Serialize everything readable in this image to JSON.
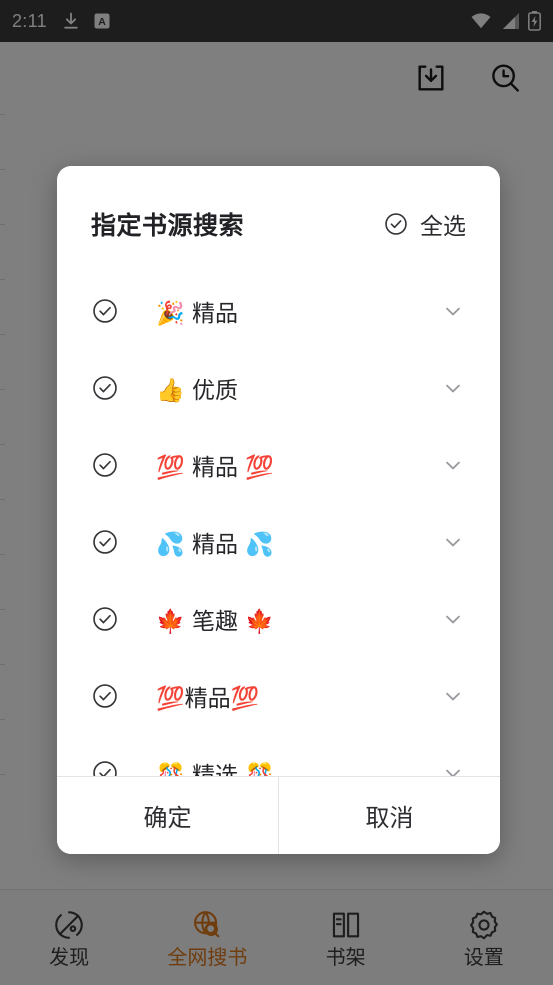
{
  "status_bar": {
    "clock": "2:11",
    "left_icons": [
      "download-icon",
      "android-auto-icon"
    ],
    "right_icons": [
      "wifi-icon",
      "cellular-signal-icon",
      "battery-charging-icon"
    ]
  },
  "app_toolbar": {
    "buttons": [
      {
        "name": "import-source-icon",
        "label": ""
      },
      {
        "name": "search-history-icon",
        "label": ""
      }
    ]
  },
  "dialog": {
    "title": "指定书源搜索",
    "select_all": {
      "label": "全选",
      "icon": "check-circle-icon",
      "checked": true
    },
    "sources": [
      {
        "name": "🎉 精品",
        "checked": true,
        "expand_icon": "chevron-down-icon"
      },
      {
        "name": "👍 优质",
        "checked": true,
        "expand_icon": "chevron-down-icon"
      },
      {
        "name": "💯 精品 💯",
        "checked": true,
        "expand_icon": "chevron-down-icon"
      },
      {
        "name": "💦 精品 💦",
        "checked": true,
        "expand_icon": "chevron-down-icon"
      },
      {
        "name": "🍁 笔趣 🍁",
        "checked": true,
        "expand_icon": "chevron-down-icon"
      },
      {
        "name": "💯精品💯",
        "checked": true,
        "expand_icon": "chevron-down-icon"
      },
      {
        "name": "🎊 精选 🎊",
        "checked": true,
        "expand_icon": "chevron-down-icon"
      }
    ],
    "confirm_label": "确定",
    "cancel_label": "取消"
  },
  "bottom_nav": {
    "items": [
      {
        "label": "发现",
        "icon": "compass-icon",
        "active": false
      },
      {
        "label": "全网搜书",
        "icon": "globe-search-icon",
        "active": true
      },
      {
        "label": "书架",
        "icon": "bookshelf-icon",
        "active": false
      },
      {
        "label": "设置",
        "icon": "gear-icon",
        "active": false
      }
    ]
  },
  "colors": {
    "accent": "#e07a1f",
    "status_bar_bg": "#3a3a3a",
    "scrim": "rgba(0,0,0,0.5)",
    "dialog_bg": "#ffffff",
    "text_primary": "#26262a",
    "text_muted": "#9a9a9f"
  }
}
